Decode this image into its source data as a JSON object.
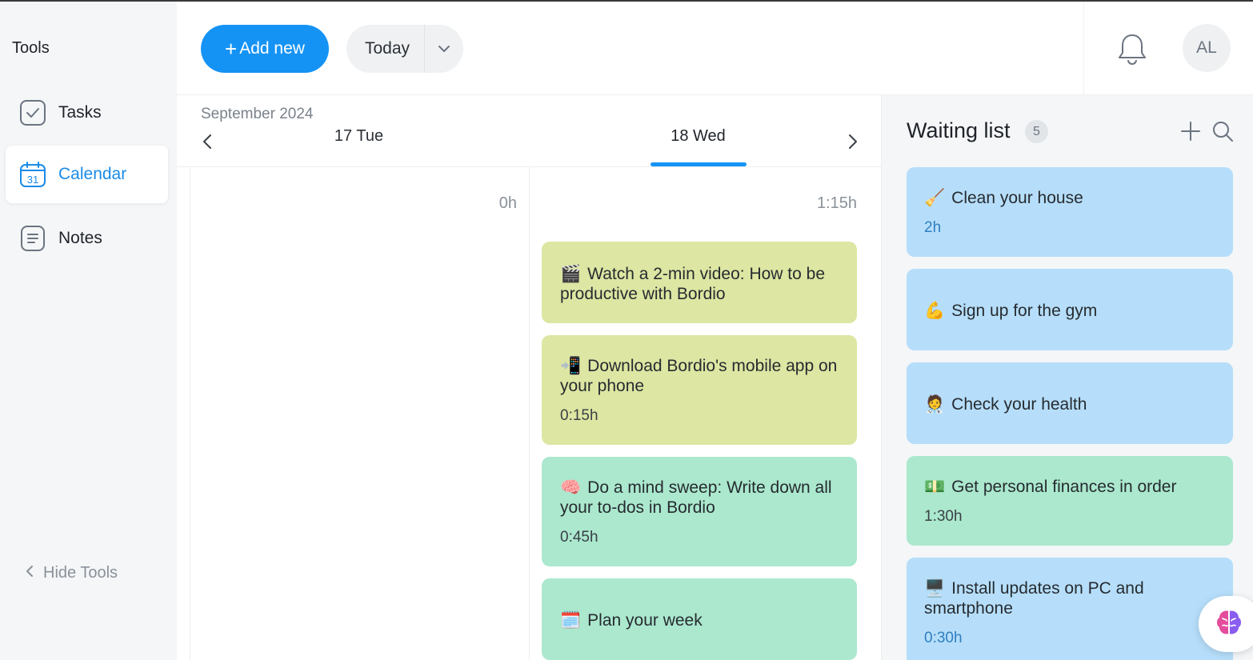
{
  "sidebar": {
    "title": "Tools",
    "items": [
      {
        "label": "Tasks",
        "icon": "check-square-icon"
      },
      {
        "label": "Calendar",
        "icon": "calendar-icon",
        "icon_text": "31",
        "active": true
      },
      {
        "label": "Notes",
        "icon": "note-icon"
      }
    ],
    "hide_tools": "Hide Tools"
  },
  "header": {
    "add_new": "Add new",
    "today": "Today",
    "avatar_initials": "AL"
  },
  "calendar": {
    "month": "September 2024",
    "days": [
      {
        "label": "17 Tue",
        "duration": "0h"
      },
      {
        "label": "18 Wed",
        "duration": "1:15h",
        "selected": true
      }
    ],
    "tasks": [
      {
        "emoji": "🎬",
        "title": "Watch a 2-min video: How to be productive with Bordio",
        "duration": "",
        "color": "#dde6a2"
      },
      {
        "emoji": "📲",
        "title": "Download Bordio's mobile app on your phone",
        "duration": "0:15h",
        "color": "#dde6a2"
      },
      {
        "emoji": "🧠",
        "title": "Do a mind sweep: Write down all your to-dos in Bordio",
        "duration": "0:45h",
        "color": "#abe8ce"
      },
      {
        "emoji": "🗓️",
        "title": "Plan your week",
        "duration": "",
        "color": "#abe8ce"
      }
    ]
  },
  "waiting_list": {
    "title": "Waiting list",
    "count": "5",
    "items": [
      {
        "emoji": "🧹",
        "title": "Clean your house",
        "duration": "2h",
        "color": "#b6defa"
      },
      {
        "emoji": "💪",
        "title": "Sign up for the gym",
        "duration": "",
        "color": "#b6defa"
      },
      {
        "emoji": "🧑‍⚕️",
        "title": "Check your health",
        "duration": "",
        "color": "#b6defa"
      },
      {
        "emoji": "💵",
        "title": "Get personal finances in order",
        "duration": "1:30h",
        "color": "#abe8ce"
      },
      {
        "emoji": "🖥️",
        "title": "Install updates on PC and smartphone",
        "duration": "0:30h",
        "color": "#b6defa"
      }
    ]
  },
  "colors": {
    "accent": "#1593f5",
    "sidebar_bg": "#f4f6f8"
  }
}
